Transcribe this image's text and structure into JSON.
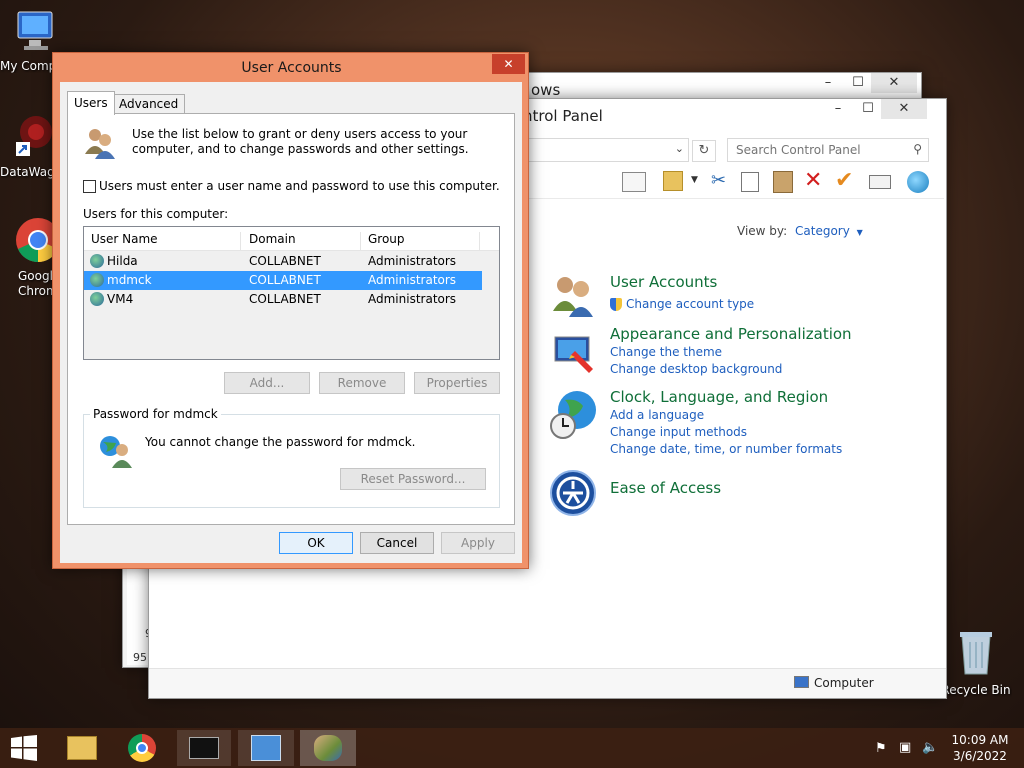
{
  "desktop": {
    "icons": [
      {
        "label": "My Comp"
      },
      {
        "label": "DataWag"
      },
      {
        "label": "Googl Chrom"
      },
      {
        "label": "Recycle Bin"
      }
    ]
  },
  "back_window": {
    "title_fragment": "ows"
  },
  "control_panel": {
    "title_fragment": "ntrol Panel",
    "search_placeholder": "Search Control Panel",
    "view_by_label": "View by:",
    "view_by_value": "Category",
    "categories": [
      {
        "title": "User Accounts",
        "links": [
          "Change account type"
        ]
      },
      {
        "title": "Appearance and Personalization",
        "links": [
          "Change the theme",
          "Change desktop background"
        ]
      },
      {
        "title": "Clock, Language, and Region",
        "links": [
          "Add a language",
          "Change input methods",
          "Change date, time, or number formats"
        ]
      },
      {
        "title": "Ease of Access",
        "links": []
      }
    ],
    "status_label": "Computer",
    "left_fragments": [
      "9",
      "95"
    ]
  },
  "dialog": {
    "title": "User Accounts",
    "tabs": [
      "Users",
      "Advanced"
    ],
    "intro": "Use the list below to grant or deny users access to your computer, and to change passwords and other settings.",
    "checkbox_label": "Users must enter a user name and password to use this computer.",
    "list_label": "Users for this computer:",
    "columns": [
      "User Name",
      "Domain",
      "Group"
    ],
    "rows": [
      {
        "name": "Hilda",
        "domain": "COLLABNET",
        "group": "Administrators"
      },
      {
        "name": "mdmck",
        "domain": "COLLABNET",
        "group": "Administrators"
      },
      {
        "name": "VM4",
        "domain": "COLLABNET",
        "group": "Administrators"
      }
    ],
    "buttons": {
      "add": "Add...",
      "remove": "Remove",
      "properties": "Properties",
      "reset": "Reset Password...",
      "ok": "OK",
      "cancel": "Cancel",
      "apply": "Apply"
    },
    "password_group": "Password for mdmck",
    "password_message": "You cannot change the password for mdmck."
  },
  "taskbar": {
    "time": "10:09 AM",
    "date": "3/6/2022"
  },
  "colors": {
    "dialog_frame": "#f0926a",
    "selection": "#3399ff",
    "link": "#1e5ebe",
    "heading": "#0f6f38"
  }
}
